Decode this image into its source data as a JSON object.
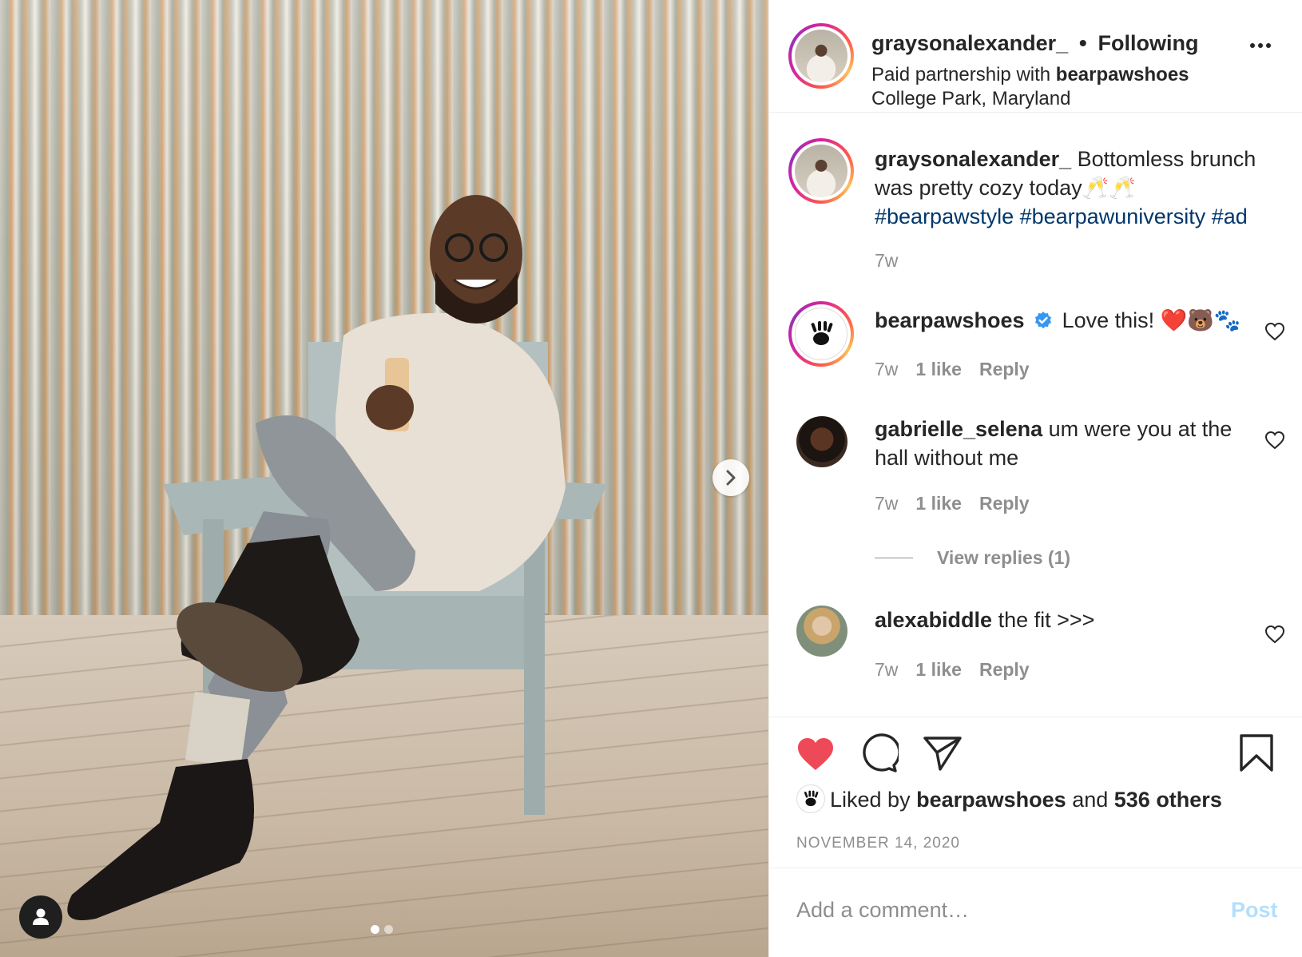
{
  "post": {
    "author": "graysonalexander_",
    "follow_status": "Following",
    "partnership_prefix": "Paid partnership with",
    "partner": "bearpawshoes",
    "location": "College Park, Maryland"
  },
  "caption": {
    "username": "graysonalexander_",
    "text": "Bottomless brunch was pretty cozy today🥂🥂",
    "hashtags": "#bearpawstyle #bearpawuniversity #ad",
    "time": "7w"
  },
  "comments": [
    {
      "username": "bearpawshoes",
      "verified": true,
      "text": "Love this! ❤️🐻🐾",
      "time": "7w",
      "likes": "1 like",
      "reply": "Reply"
    },
    {
      "username": "gabrielle_selena",
      "text": "um were you at the hall without me",
      "time": "7w",
      "likes": "1 like",
      "reply": "Reply",
      "view_replies": "View replies (1)"
    },
    {
      "username": "alexabiddle",
      "text": "the fit >>>",
      "time": "7w",
      "likes": "1 like",
      "reply": "Reply"
    }
  ],
  "likes": {
    "prefix": "Liked by",
    "user": "bearpawshoes",
    "joiner": "and",
    "others": "536 others"
  },
  "date": "NOVEMBER 14, 2020",
  "composer": {
    "placeholder": "Add a comment…",
    "post_label": "Post"
  },
  "colors": {
    "like_red": "#ed4956",
    "link_blue": "#00376b",
    "verified_blue": "#3897f0",
    "post_disabled": "#b2dffc"
  },
  "carousel": {
    "slide": 1,
    "total": 2
  }
}
